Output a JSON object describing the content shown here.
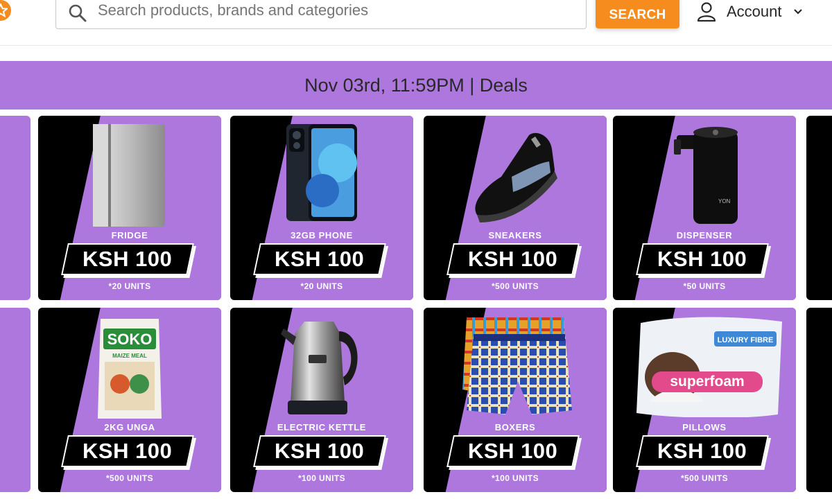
{
  "header": {
    "logo_icon": "star-icon",
    "search": {
      "placeholder": "Search products, brands and categories",
      "value": ""
    },
    "search_button": "SEARCH",
    "account_label": "Account"
  },
  "banner": {
    "title": "Nov 03rd, 11:59PM | Deals"
  },
  "colors": {
    "brand_orange": "#f68b1e",
    "deals_purple": "#ad77de",
    "card_black": "#000000"
  },
  "products": [
    {
      "name": "FRIDGE",
      "price": "KSH 100",
      "units": "*20 UNITS",
      "icon": "fridge-image"
    },
    {
      "name": "32GB PHONE",
      "price": "KSH 100",
      "units": "*20 UNITS",
      "icon": "phone-image"
    },
    {
      "name": "SNEAKERS",
      "price": "KSH 100",
      "units": "*500 UNITS",
      "icon": "sneaker-image"
    },
    {
      "name": "DISPENSER",
      "price": "KSH 100",
      "units": "*50 UNITS",
      "icon": "dispenser-image"
    },
    {
      "name": "2KG UNGA",
      "price": "KSH 100",
      "units": "*500 UNITS",
      "icon": "flour-bag-image",
      "brand": "SOKO",
      "sub": "MAIZE MEAL"
    },
    {
      "name": "ELECTRIC KETTLE",
      "price": "KSH 100",
      "units": "*100 UNITS",
      "icon": "kettle-image"
    },
    {
      "name": "BOXERS",
      "price": "KSH 100",
      "units": "*100 UNITS",
      "icon": "boxers-image"
    },
    {
      "name": "PILLOWS",
      "price": "KSH 100",
      "units": "*500 UNITS",
      "icon": "pillow-image",
      "brand": "superfoam",
      "sub": "LUXURY FIBRE"
    }
  ]
}
